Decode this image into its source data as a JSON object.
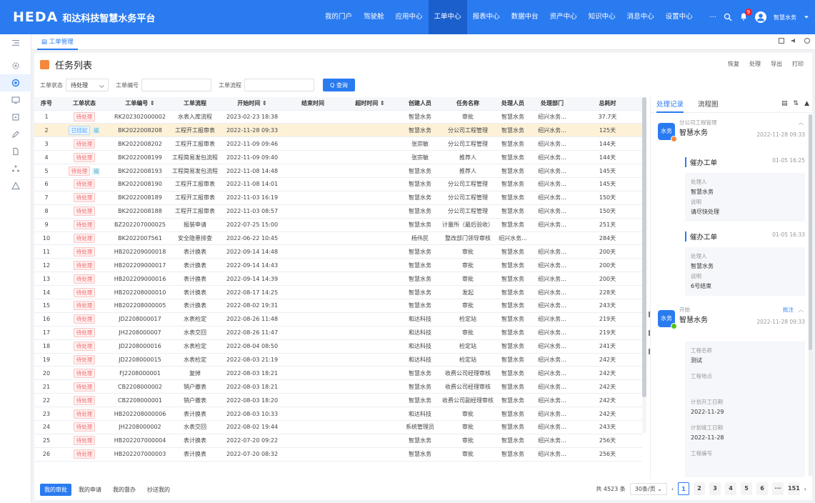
{
  "app": {
    "logo": "HEDA",
    "name": "和达科技智慧水务平台"
  },
  "nav": [
    "我的门户",
    "驾驶舱",
    "应用中心",
    "工单中心",
    "报表中心",
    "数据中台",
    "资产中心",
    "知识中心",
    "消息中心",
    "设置中心"
  ],
  "nav_active": 3,
  "topbar": {
    "more": "···",
    "badge": "9",
    "user": "智慧水务"
  },
  "tab": {
    "label": "工单管理"
  },
  "page": {
    "title": "任务列表",
    "actions": [
      "恢复",
      "处理",
      "导出",
      "打印"
    ]
  },
  "filters": {
    "status_label": "工单状态",
    "status_value": "待处理",
    "code_label": "工单编号",
    "code_value": "",
    "flow_label": "工单流程",
    "flow_value": "",
    "query_label": "Q 查询"
  },
  "columns": [
    "序号",
    "工单状态",
    "工单编号 ⇕",
    "工单流程",
    "开始时间 ⇕",
    "结束时间",
    "超时时间 ⇕",
    "创建人员",
    "任务名称",
    "处理人员",
    "处理部门",
    "总耗时"
  ],
  "rows": [
    {
      "no": "1",
      "status": "待处理",
      "tag": "",
      "code": "RK202302000002",
      "flow": "水表入库流程",
      "start": "2023-02-23 18:38",
      "creator": "智慧水务",
      "task": "审批",
      "handler": "智慧水务",
      "dept": "绍兴水务...",
      "total": "37.7天"
    },
    {
      "no": "2",
      "status": "已挂起",
      "tag": "阅",
      "code": "BK2022008208",
      "flow": "工程开工报审表",
      "start": "2022-11-28 09:33",
      "creator": "智慧水务",
      "task": "分公司工程管理",
      "handler": "智慧水务",
      "dept": "绍兴水务...",
      "total": "125天"
    },
    {
      "no": "3",
      "status": "待处理",
      "tag": "",
      "code": "BK2022008202",
      "flow": "工程开工报审表",
      "start": "2022-11-09 09:46",
      "creator": "张宗敏",
      "task": "分公司工程管理",
      "handler": "智慧水务",
      "dept": "绍兴水务...",
      "total": "144天"
    },
    {
      "no": "4",
      "status": "待处理",
      "tag": "",
      "code": "BK2022008199",
      "flow": "工程简易发包流程",
      "start": "2022-11-09 09:40",
      "creator": "张宗敏",
      "task": "推荐人",
      "handler": "智慧水务",
      "dept": "绍兴水务...",
      "total": "144天"
    },
    {
      "no": "5",
      "status": "待处理",
      "tag": "阅",
      "code": "BK2022008193",
      "flow": "工程简易发包流程",
      "start": "2022-11-08 14:48",
      "creator": "智慧水务",
      "task": "推荐人",
      "handler": "智慧水务",
      "dept": "绍兴水务...",
      "total": "145天"
    },
    {
      "no": "6",
      "status": "待处理",
      "tag": "",
      "code": "BK2022008190",
      "flow": "工程开工报审表",
      "start": "2022-11-08 14:01",
      "creator": "智慧水务",
      "task": "分公司工程管理",
      "handler": "智慧水务",
      "dept": "绍兴水务...",
      "total": "145天"
    },
    {
      "no": "7",
      "status": "待处理",
      "tag": "",
      "code": "BK2022008189",
      "flow": "工程开工报审表",
      "start": "2022-11-03 16:19",
      "creator": "智慧水务",
      "task": "分公司工程管理",
      "handler": "智慧水务",
      "dept": "绍兴水务...",
      "total": "150天"
    },
    {
      "no": "8",
      "status": "待处理",
      "tag": "",
      "code": "BK2022008188",
      "flow": "工程开工报审表",
      "start": "2022-11-03 08:57",
      "creator": "智慧水务",
      "task": "分公司工程管理",
      "handler": "智慧水务",
      "dept": "绍兴水务...",
      "total": "150天"
    },
    {
      "no": "9",
      "status": "待处理",
      "tag": "",
      "code": "BZ202207000025",
      "flow": "报装申请",
      "start": "2022-07-25 15:00",
      "creator": "智慧水务",
      "task": "计量所（最后验收）",
      "handler": "智慧水务",
      "dept": "绍兴水务...",
      "total": "251天"
    },
    {
      "no": "10",
      "status": "待处理",
      "tag": "",
      "code": "BK2022007561",
      "flow": "安全隐患排查",
      "start": "2022-06-22 10:45",
      "creator": "杨伟民",
      "task": "整改部门领导审核",
      "handler": "绍兴水务...",
      "dept": "",
      "total": "284天"
    },
    {
      "no": "11",
      "status": "待处理",
      "tag": "",
      "code": "HB202209000018",
      "flow": "表计换表",
      "start": "2022-09-14 14:48",
      "creator": "智慧水务",
      "task": "审批",
      "handler": "智慧水务",
      "dept": "绍兴水务...",
      "total": "200天"
    },
    {
      "no": "12",
      "status": "待处理",
      "tag": "",
      "code": "HB202209000017",
      "flow": "表计换表",
      "start": "2022-09-14 14:43",
      "creator": "智慧水务",
      "task": "审批",
      "handler": "智慧水务",
      "dept": "绍兴水务...",
      "total": "200天"
    },
    {
      "no": "13",
      "status": "待处理",
      "tag": "",
      "code": "HB202209000016",
      "flow": "表计换表",
      "start": "2022-09-14 14:39",
      "creator": "智慧水务",
      "task": "审批",
      "handler": "智慧水务",
      "dept": "绍兴水务...",
      "total": "200天"
    },
    {
      "no": "14",
      "status": "待处理",
      "tag": "",
      "code": "HB202208000010",
      "flow": "表计换表",
      "start": "2022-08-17 14:25",
      "creator": "智慧水务",
      "task": "发起",
      "handler": "智慧水务",
      "dept": "绍兴水务...",
      "total": "228天"
    },
    {
      "no": "15",
      "status": "待处理",
      "tag": "",
      "code": "HB202208000005",
      "flow": "表计换表",
      "start": "2022-08-02 19:31",
      "creator": "智慧水务",
      "task": "审批",
      "handler": "智慧水务",
      "dept": "绍兴水务...",
      "total": "243天"
    },
    {
      "no": "16",
      "status": "待处理",
      "tag": "",
      "code": "JD2208000017",
      "flow": "水表检定",
      "start": "2022-08-26 11:48",
      "creator": "和达科技",
      "task": "检定站",
      "handler": "智慧水务",
      "dept": "绍兴水务...",
      "total": "219天"
    },
    {
      "no": "17",
      "status": "待处理",
      "tag": "",
      "code": "JH2208000007",
      "flow": "水表交回",
      "start": "2022-08-26 11:47",
      "creator": "和达科技",
      "task": "审批",
      "handler": "智慧水务",
      "dept": "绍兴水务...",
      "total": "219天"
    },
    {
      "no": "18",
      "status": "待处理",
      "tag": "",
      "code": "JD2208000016",
      "flow": "水表检定",
      "start": "2022-08-04 08:50",
      "creator": "和达科技",
      "task": "检定站",
      "handler": "智慧水务",
      "dept": "绍兴水务...",
      "total": "241天"
    },
    {
      "no": "19",
      "status": "待处理",
      "tag": "",
      "code": "JD2208000015",
      "flow": "水表检定",
      "start": "2022-08-03 21:19",
      "creator": "和达科技",
      "task": "检定站",
      "handler": "智慧水务",
      "dept": "绍兴水务...",
      "total": "242天"
    },
    {
      "no": "20",
      "status": "待处理",
      "tag": "",
      "code": "FJ2208000001",
      "flow": "复掉",
      "start": "2022-08-03 18:21",
      "creator": "智慧水务",
      "task": "收费公司经理审核",
      "handler": "智慧水务",
      "dept": "绍兴水务...",
      "total": "242天"
    },
    {
      "no": "21",
      "status": "待处理",
      "tag": "",
      "code": "CB2208000002",
      "flow": "销户撤表",
      "start": "2022-08-03 18:21",
      "creator": "智慧水务",
      "task": "收费公司经理审核",
      "handler": "智慧水务",
      "dept": "绍兴水务...",
      "total": "242天"
    },
    {
      "no": "22",
      "status": "待处理",
      "tag": "",
      "code": "CB2208000001",
      "flow": "销户撤表",
      "start": "2022-08-03 18:20",
      "creator": "智慧水务",
      "task": "收费公司副经理审核",
      "handler": "智慧水务",
      "dept": "绍兴水务...",
      "total": "242天"
    },
    {
      "no": "23",
      "status": "待处理",
      "tag": "",
      "code": "HB202208000006",
      "flow": "表计换表",
      "start": "2022-08-03 10:33",
      "creator": "和达科技",
      "task": "审批",
      "handler": "智慧水务",
      "dept": "绍兴水务...",
      "total": "242天"
    },
    {
      "no": "24",
      "status": "待处理",
      "tag": "",
      "code": "JH2208000002",
      "flow": "水表交回",
      "start": "2022-08-02 19:44",
      "creator": "系统管理员",
      "task": "审批",
      "handler": "智慧水务",
      "dept": "绍兴水务...",
      "total": "243天"
    },
    {
      "no": "25",
      "status": "待处理",
      "tag": "",
      "code": "HB202207000004",
      "flow": "表计换表",
      "start": "2022-07-20 09:22",
      "creator": "智慧水务",
      "task": "审批",
      "handler": "智慧水务",
      "dept": "绍兴水务...",
      "total": "256天"
    },
    {
      "no": "26",
      "status": "待处理",
      "tag": "",
      "code": "HB202207000003",
      "flow": "表计换表",
      "start": "2022-07-20 08:32",
      "creator": "智慧水务",
      "task": "审批",
      "handler": "智慧水务",
      "dept": "绍兴水务...",
      "total": "256天"
    }
  ],
  "footer": {
    "tabs": [
      "我的审批",
      "我的申请",
      "我的督办",
      "抄送我的"
    ],
    "total": "共 4523 条",
    "page_size": "30条/页",
    "pages": [
      "1",
      "2",
      "3",
      "4",
      "5",
      "6",
      "···",
      "151"
    ]
  },
  "panel": {
    "tabs": [
      "处理记录",
      "流程图"
    ],
    "avatar_text": "水务",
    "rec1": {
      "node": "分公司工程管理",
      "user": "智慧水务",
      "date": "2022-11-28 09:33"
    },
    "urge1": {
      "title": "催办工单",
      "date": "01-05 16:25",
      "k1": "处理人",
      "v1": "智慧水务",
      "k2": "说明",
      "v2": "请尽快处理"
    },
    "urge2": {
      "title": "催办工单",
      "date": "01-05 16:33",
      "k1": "处理人",
      "v1": "智慧水务",
      "k2": "说明",
      "v2": "6号结束"
    },
    "rec2": {
      "node": "开始",
      "note": "批注",
      "user": "智慧水务",
      "date": "2022-11-28 09:33"
    },
    "form": {
      "k1": "工程名称",
      "v1": "测试",
      "k2": "工程地点",
      "k3": "计划开工日期",
      "v3": "2022-11-29",
      "k4": "计划竣工日期",
      "v4": "2022-11-28",
      "k5": "工程编号"
    }
  },
  "colors": {
    "primary": "#2a7bf0",
    "pending_red": "#f56c6c",
    "highlight_row": "#fdf1d8",
    "header_icon": "#f5883a"
  }
}
